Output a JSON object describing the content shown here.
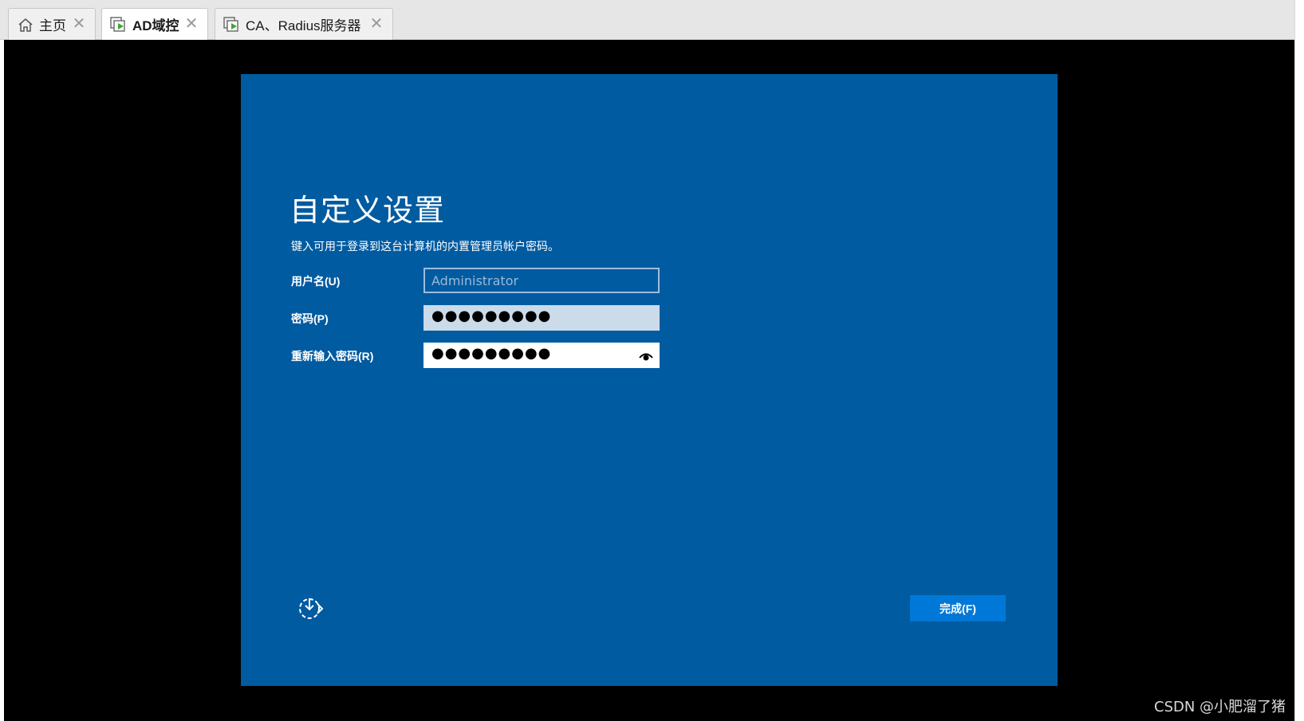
{
  "tabs": [
    {
      "label": "主页",
      "icon": "home-icon",
      "active": false
    },
    {
      "label": "AD域控",
      "icon": "vm-running-icon",
      "active": true
    },
    {
      "label": "CA、Radius服务器",
      "icon": "vm-running-icon",
      "active": false
    }
  ],
  "tab_close_glyph": "✕",
  "oobe": {
    "title": "自定义设置",
    "description": "键入可用于登录到这台计算机的内置管理员帐户密码。",
    "username_label": "用户名(U)",
    "username_placeholder": "Administrator",
    "password_label": "密码(P)",
    "password_value": "●●●●●●●●●",
    "repassword_label": "重新输入密码(R)",
    "repassword_value": "●●●●●●●●●",
    "finish_label": "完成(F)"
  },
  "watermark": "CSDN @小肥溜了猪",
  "colors": {
    "oobe_background": "#005ba1",
    "finish_button": "#0078d7",
    "vm_background": "#000000"
  }
}
